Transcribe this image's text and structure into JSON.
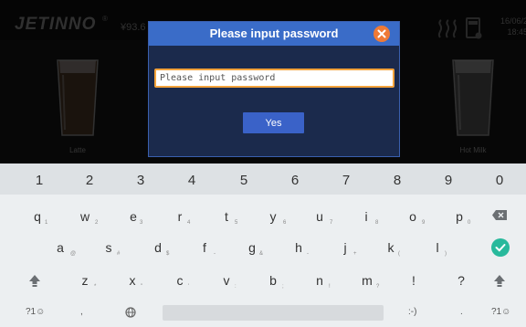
{
  "kiosk": {
    "brand": "JETINNO",
    "trademark": "®",
    "price": "¥93.6",
    "date": "16/06/2",
    "time": "18:45",
    "drinks": [
      {
        "label": "Latte"
      },
      {
        "label": "Hot Milk"
      }
    ]
  },
  "dialog": {
    "title": "Please input password",
    "input_placeholder": "Please input password",
    "input_value": "",
    "confirm_label": "Yes"
  },
  "keyboard": {
    "numbers": [
      "1",
      "2",
      "3",
      "4",
      "5",
      "6",
      "7",
      "8",
      "9",
      "0"
    ],
    "row1": [
      "q",
      "w",
      "e",
      "r",
      "t",
      "y",
      "u",
      "i",
      "o",
      "p"
    ],
    "row1_hints": [
      "1",
      "2",
      "3",
      "4",
      "5",
      "6",
      "7",
      "8",
      "9",
      "0"
    ],
    "row2": [
      "a",
      "s",
      "d",
      "f",
      "g",
      "h",
      "j",
      "k",
      "l"
    ],
    "row2_hints": [
      "@",
      "#",
      "$",
      "-",
      "&",
      "-",
      "+",
      "(",
      ")"
    ],
    "row3": [
      "z",
      "x",
      "c",
      "v",
      "b",
      "n",
      "m",
      "!",
      "?"
    ],
    "row3_hints": [
      "*",
      "\"",
      "'",
      ":",
      ";",
      "!",
      "?",
      "",
      ""
    ],
    "bottom": {
      "symbols_left": "?1☺",
      "comma": ",",
      "emoticon": ":-)",
      "period": ".",
      "symbols_right": "?1☺"
    },
    "accent_color": "#28b99c"
  },
  "colors": {
    "dialog_header": "#3a6cc8",
    "dialog_body": "#1b2a4c",
    "close_button": "#ef7a36",
    "input_border": "#f3a33c",
    "yes_button": "#3a62c8"
  }
}
